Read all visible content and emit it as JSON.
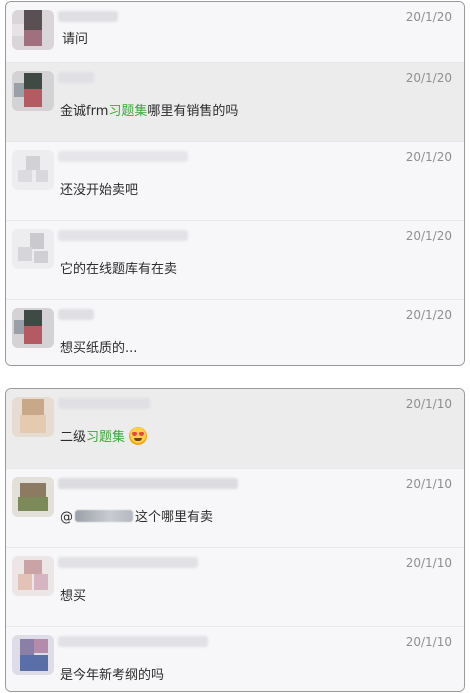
{
  "panel1": {
    "messages": [
      {
        "time": "20/1/20",
        "text": "请问"
      },
      {
        "time": "20/1/20",
        "text_before": "金诚frm",
        "highlight": "习题集",
        "text_after": "哪里有销售的吗"
      },
      {
        "time": "20/1/20",
        "text": "还没开始卖吧"
      },
      {
        "time": "20/1/20",
        "text": "它的在线题库有在卖"
      },
      {
        "time": "20/1/20",
        "text": "想买纸质的..."
      }
    ]
  },
  "panel2": {
    "messages": [
      {
        "time": "20/1/10",
        "text_before": "二级",
        "highlight": "习题集",
        "emoji": "heart-eyes-emoji"
      },
      {
        "time": "20/1/10",
        "mention": "@",
        "text_after": "这个哪里有卖"
      },
      {
        "time": "20/1/10",
        "text": "想买"
      },
      {
        "time": "20/1/10",
        "text": "是今年新考纲的吗"
      }
    ]
  },
  "colors": {
    "highlight_green": "#3aa83a",
    "row_highlight": "#ececec",
    "panel_bg": "#f7f7f9",
    "timestamp": "#8f8f8f"
  }
}
